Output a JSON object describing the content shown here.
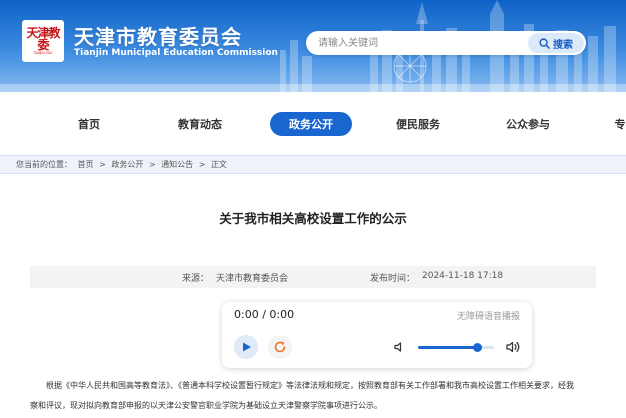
{
  "header": {
    "logo_text": "天津教委",
    "logo_sub": "TIANJIN EDU",
    "title": "天津市教育委员会",
    "subtitle": "Tianjin Municipal Education Commission",
    "search": {
      "placeholder": "请输入关键词",
      "button_label": "搜索"
    }
  },
  "nav": {
    "items": [
      {
        "label": "首页"
      },
      {
        "label": "教育动态"
      },
      {
        "label": "政务公开",
        "active": true
      },
      {
        "label": "便民服务"
      },
      {
        "label": "公众参与"
      },
      {
        "label": "专"
      }
    ]
  },
  "breadcrumb": {
    "prefix": "您当前的位置：",
    "items": [
      "首页",
      "政务公开",
      "通知公告",
      "正文"
    ],
    "separator": ">"
  },
  "article": {
    "title": "关于我市相关高校设置工作的公示",
    "source_label": "来源：",
    "source": "天津市教育委员会",
    "time_label": "发布时间：",
    "time": "2024-11-18 17:18",
    "body": [
      "根据《中华人民共和国高等教育法》、《普通本科学校设置暂行规定》等法律法规和规定，按照教育部有关工作部署和我市高校设置工作相关要求，经我",
      "察和评议，现对拟向教育部申报的以天津公安警官职业学院为基础设立天津警察学院事项进行公示。"
    ]
  },
  "player": {
    "time": "0:00 / 0:00",
    "label": "无障碍语音播报",
    "volume": 0.78
  },
  "colors": {
    "primary": "#1a66d0",
    "banner": "#0f63c7",
    "seal": "#c8161d"
  }
}
